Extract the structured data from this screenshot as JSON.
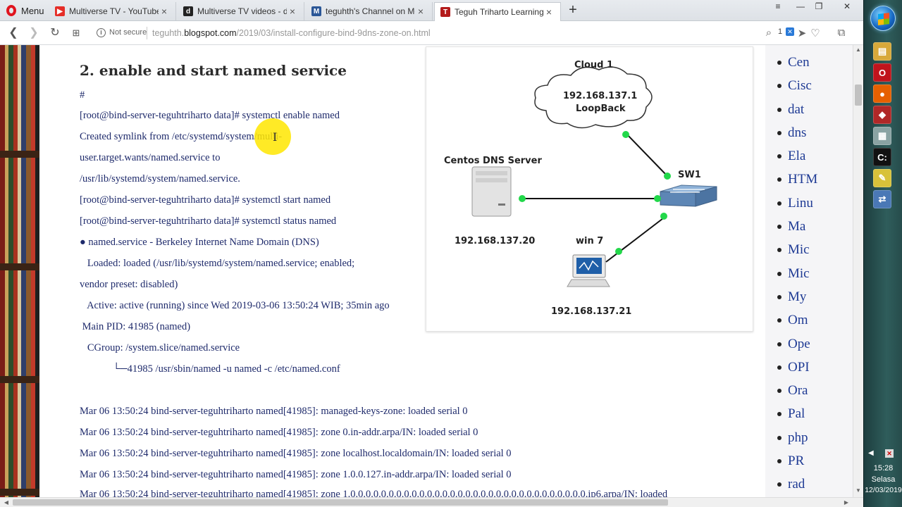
{
  "browser": {
    "menu_label": "Menu",
    "tabs": [
      {
        "title": "Multiverse TV - YouTube",
        "favicon": "youtube-icon",
        "fav_color": "#e52d27",
        "fav_glyph": "▶"
      },
      {
        "title": "Multiverse TV videos - dai",
        "favicon": "dailymotion-icon",
        "fav_color": "#222222",
        "fav_glyph": "d"
      },
      {
        "title": "teguhth's Channel on Met",
        "favicon": "metacafe-icon",
        "fav_color": "#2b5797",
        "fav_glyph": "M"
      },
      {
        "title": "Teguh Triharto Learning C",
        "favicon": "blogger-icon",
        "fav_color": "#b31b1b",
        "fav_glyph": "T"
      }
    ],
    "close_glyph": "×",
    "new_tab_glyph": "+",
    "window_controls": [
      "≡",
      "—",
      "❐",
      "✕"
    ],
    "address": {
      "security_label": "Not secure",
      "url_prefix": "teguhth.",
      "url_domain": "blogspot.com",
      "url_path": "/2019/03/install-configure-bind-9dns-zone-on.html",
      "badge_count": "1"
    }
  },
  "article": {
    "heading": "2. enable and start named service",
    "lines": [
      "#",
      "[root@bind-server-teguhtriharto data]# systemctl enable named",
      "Created symlink from /etc/systemd/system/multi-",
      "user.target.wants/named.service to",
      "/usr/lib/systemd/system/named.service.",
      "[root@bind-server-teguhtriharto data]# systemctl start  named",
      "[root@bind-server-teguhtriharto data]# systemctl status  named",
      "● named.service - Berkeley Internet Name Domain (DNS)",
      "   Loaded: loaded (/usr/lib/systemd/system/named.service; enabled;",
      "vendor preset: disabled)",
      "   Active: active (running) since Wed 2019-03-06 13:50:24 WIB; 35min ago",
      " Main PID: 41985 (named)",
      "   CGroup: /system.slice/named.service",
      "             └─41985 /usr/sbin/named -u named -c /etc/named.conf"
    ],
    "log_lines": [
      "Mar 06 13:50:24 bind-server-teguhtriharto named[41985]: managed-keys-zone: loaded serial 0",
      "Mar 06 13:50:24 bind-server-teguhtriharto named[41985]: zone 0.in-addr.arpa/IN: loaded serial 0",
      "Mar 06 13:50:24 bind-server-teguhtriharto named[41985]: zone localhost.localdomain/IN: loaded serial 0",
      "Mar 06 13:50:24 bind-server-teguhtriharto named[41985]: zone 1.0.0.127.in-addr.arpa/IN: loaded serial 0",
      "Mar 06 13:50:24 bind-server-teguhtriharto named[41985]: zone 1.0.0.0.0.0.0.0.0.0.0.0.0.0.0.0.0.0.0.0.0.0.0.0.0.0.0.0.0.0.0.0.ip6.arpa/IN: loaded"
    ],
    "diagram": {
      "cloud_title": "Cloud 1",
      "cloud_ip": "192.168.137.1",
      "cloud_sub": "LoopBack",
      "server_title": "Centos DNS Server",
      "server_ip": "192.168.137.20",
      "switch_title": "SW1",
      "client_title": "win 7",
      "client_ip": "192.168.137.21",
      "link_color": "#22d84a"
    }
  },
  "sidebar": {
    "items": [
      "Cen",
      "Cisc",
      "dat",
      "dns",
      "Ela",
      "HTM",
      "Linu",
      "Ma",
      "Mic",
      "Mic",
      "My",
      "Om",
      "Ope",
      "OPI",
      "Ora",
      "Pal",
      "php",
      "PR",
      "rad"
    ]
  },
  "taskbar": {
    "time": "15:28",
    "day": "Selasa",
    "date": "12/03/2019"
  }
}
